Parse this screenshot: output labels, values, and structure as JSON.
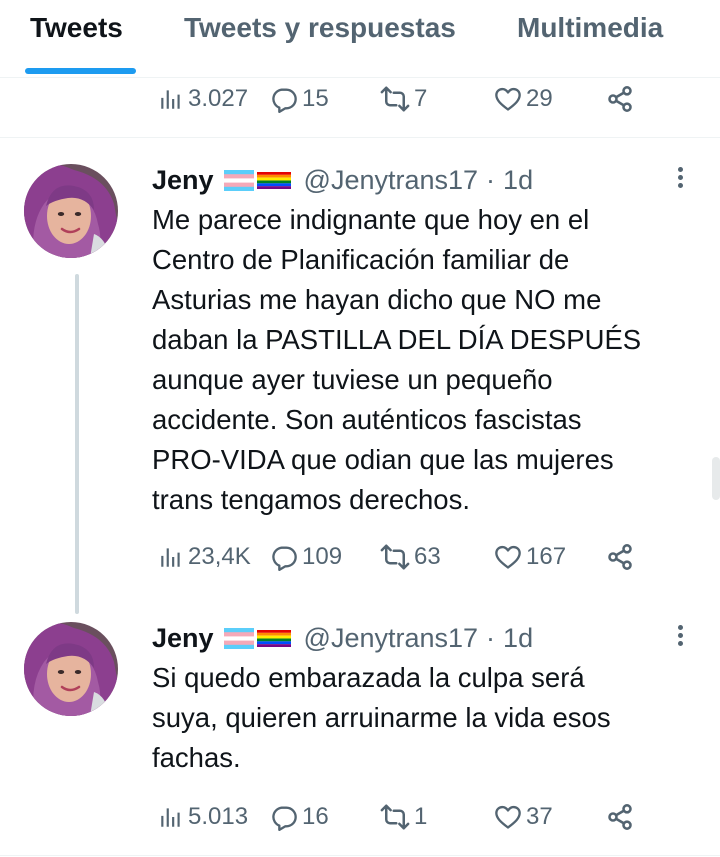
{
  "tabs": [
    {
      "label": "Tweets",
      "active": true
    },
    {
      "label": "Tweets y respuestas",
      "active": false
    },
    {
      "label": "Multimedia",
      "active": false
    }
  ],
  "accent_color": "#1d9bf0",
  "previous_tweet": {
    "views": "3.027",
    "replies": "15",
    "retweets": "7",
    "likes": "29"
  },
  "tweets": [
    {
      "name": "Jeny",
      "flags": [
        "transgender-flag",
        "rainbow-flag"
      ],
      "handle": "@Jenytrans17",
      "separator": "·",
      "time": "1d",
      "lines": [
        "Me parece indignante que hoy en el",
        "Centro de Planificación familiar de",
        "Asturias me hayan dicho que NO me",
        "daban la PASTILLA DEL DÍA DESPUÉS",
        "aunque ayer tuviese un pequeño",
        "accidente. Son auténticos fascistas",
        "PRO-VIDA que odian que las mujeres",
        "trans tengamos derechos."
      ],
      "views": "23,4K",
      "replies": "109",
      "retweets": "63",
      "likes": "167"
    },
    {
      "name": "Jeny",
      "flags": [
        "transgender-flag",
        "rainbow-flag"
      ],
      "handle": "@Jenytrans17",
      "separator": "·",
      "time": "1d",
      "lines": [
        "Si quedo embarazada la culpa será",
        "suya, quieren arruinarme la vida esos",
        "fachas."
      ],
      "views": "5.013",
      "replies": "16",
      "retweets": "1",
      "likes": "37"
    }
  ]
}
